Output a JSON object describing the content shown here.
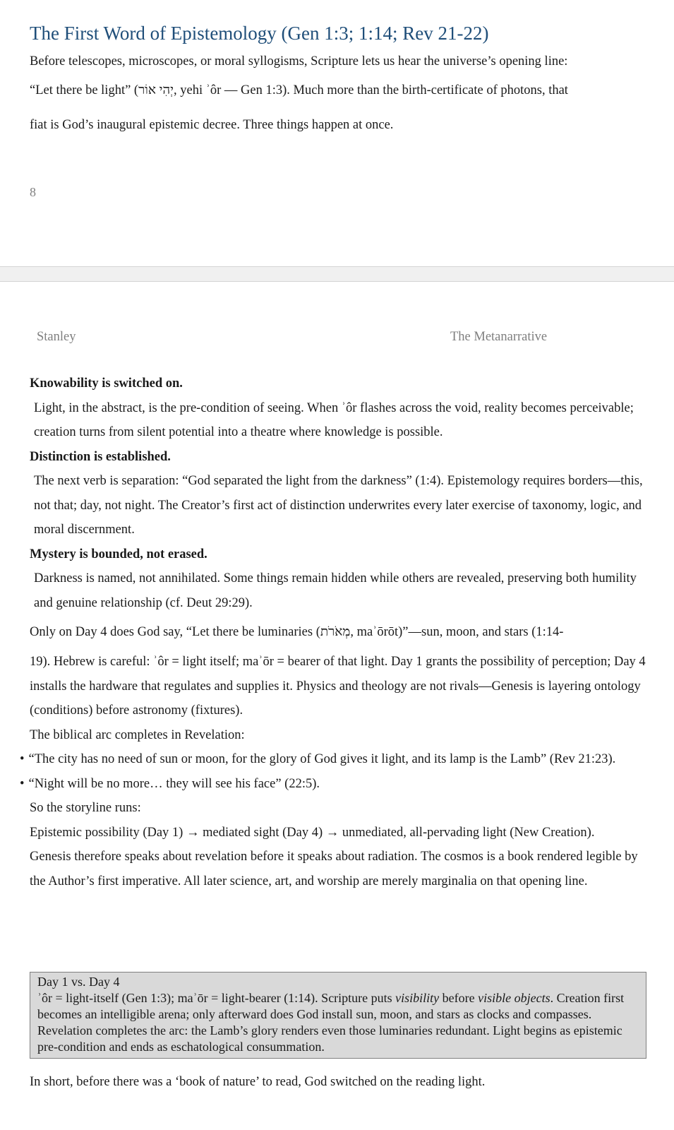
{
  "page1": {
    "heading": "The First Word of Epistemology (Gen 1:3; 1:14; Rev 21-22)",
    "intro_line1": "Before telescopes, microscopes, or moral syllogisms, Scripture lets us hear the universe’s opening line:",
    "intro_line2": "“Let there be light” (יְהִי אוֹר, yehi ʾôr — Gen 1:3). Much more than the birth-certificate of photons, that",
    "intro_line3": "fiat is God’s inaugural epistemic decree. Three things happen at once.",
    "page_number": "8"
  },
  "page2": {
    "header_left": "Stanley",
    "header_right": "The Metanarrative",
    "point1_title": "Knowability is switched on.",
    "point1_text": "Light, in the abstract, is the pre-condition of seeing. When ʾôr flashes across the void, reality becomes perceivable; creation turns from silent potential into a theatre where knowledge is possible.",
    "point2_title": "Distinction is established.",
    "point2_text": "The next verb is separation: “God separated the light from the darkness” (1:4). Epistemology requires borders—this, not that; day, not night. The Creator’s first act of distinction underwrites every later exercise of taxonomy, logic, and moral discernment.",
    "point3_title": "Mystery is bounded, not erased.",
    "point3_text": "Darkness is named, not annihilated. Some things remain hidden while others are revealed, preserving both humility and genuine relationship (cf. Deut 29:29).",
    "day4_line1": "Only on Day 4 does God say, “Let there be luminaries (מְאֹרֹת, maʾōrōt)”—sun, moon, and stars (1:14-",
    "day4_rest": "19). Hebrew is careful: ʾôr = light itself; maʾōr = bearer of that light. Day 1 grants the possibility of perception; Day 4 installs the hardware that regulates and supplies it. Physics and theology are not rivals—Genesis is layering ontology (conditions) before astronomy (fixtures).",
    "arc_intro": "The biblical arc completes in Revelation:",
    "bullets": [
      "“The city has no need of sun or moon, for the glory of God gives it light, and its lamp is the Lamb” (Rev 21:23).",
      "“Night will be no more… they will see his face” (22:5)."
    ],
    "storyline_intro": "So the storyline runs:",
    "storyline": "Epistemic possibility (Day 1) → mediated sight (Day 4) → unmediated, all-pervading light (New Creation).",
    "conclusion": "Genesis therefore speaks about revelation before it speaks about radiation. The cosmos is a book rendered legible by the Author’s first imperative. All later science, art, and worship are merely marginalia on that opening line.",
    "sidebar": {
      "title": "Day 1 vs. Day 4",
      "text_a": "ʾôr = light-itself (Gen 1:3); maʾōr = light-bearer (1:14). Scripture puts ",
      "em1": "visibility",
      "text_b": " before ",
      "em2": "visible objects",
      "text_c": ". Creation first becomes an intelligible arena; only afterward does God install sun, moon, and stars as clocks and compasses. Revelation completes the arc: the Lamb’s glory renders even those luminaries redundant. Light begins as epistemic pre-condition and ends as eschatological consummation."
    },
    "closing": "In short, before there was a ‘book of nature’ to read, God switched on the reading light."
  }
}
